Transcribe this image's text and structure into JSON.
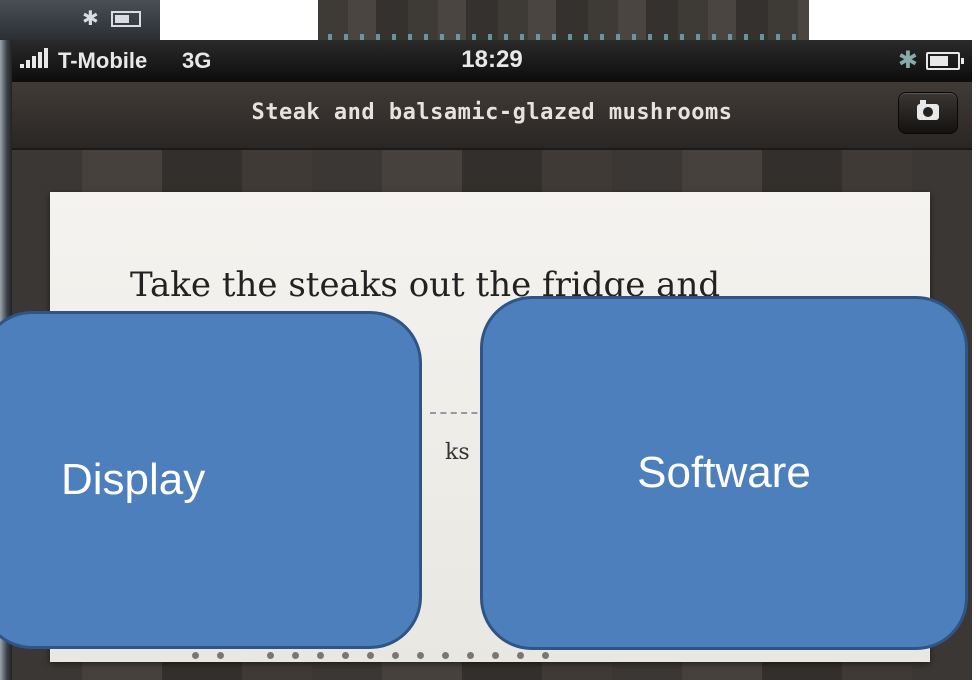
{
  "status_bar": {
    "carrier": "T-Mobile",
    "network": "3G",
    "time": "18:29"
  },
  "nav_bar": {
    "title": "Steak and balsamic-glazed mushrooms"
  },
  "recipe_card": {
    "step_text": "Take the steaks out the fridge and",
    "subtext": "ks"
  },
  "page_dots": {
    "count": 15,
    "active_index": 2
  },
  "callouts": {
    "display_label": "Display",
    "software_label": "Software",
    "fill_color": "#4e7fbd",
    "border_color": "#2f5585"
  },
  "icons": [
    "bluetooth-icon",
    "battery-icon",
    "signal-icon",
    "camera-icon"
  ]
}
